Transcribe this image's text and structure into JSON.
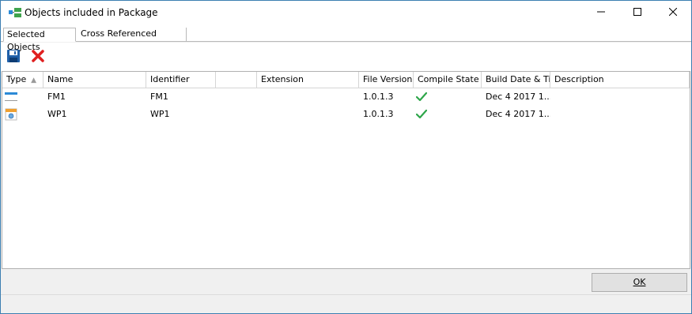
{
  "window": {
    "title": "Objects included in Package",
    "app_icon": "package-icon",
    "controls": [
      "minimize-icon",
      "maximize-icon",
      "close-icon"
    ]
  },
  "tabs": [
    {
      "label": "Selected Objects",
      "active": true
    },
    {
      "label": "Cross Referenced Objects",
      "active": false
    }
  ],
  "toolbar": {
    "save_icon": "save-icon",
    "delete_icon": "delete-icon"
  },
  "grid": {
    "columns": [
      "Type",
      "Name",
      "Identifier",
      "",
      "Extension",
      "File Version",
      "Compile State",
      "Build Date & Ti...",
      "Description"
    ],
    "rows": [
      {
        "type_icon": "form-module-icon",
        "name": "FM1",
        "identifier": "FM1",
        "extension": "",
        "file_version": "1.0.1.3",
        "compile_state": "check-icon",
        "build_date": "Dec  4 2017 1...",
        "description": ""
      },
      {
        "type_icon": "web-page-icon",
        "name": "WP1",
        "identifier": "WP1",
        "extension": "",
        "file_version": "1.0.1.3",
        "compile_state": "check-icon",
        "build_date": "Dec  4 2017 1...",
        "description": ""
      }
    ]
  },
  "footer": {
    "ok_label": "OK"
  },
  "colors": {
    "window_border": "#3c7fb1",
    "check_green": "#2ea64a",
    "delete_red": "#e02020",
    "save_blue": "#1f5fa8"
  }
}
